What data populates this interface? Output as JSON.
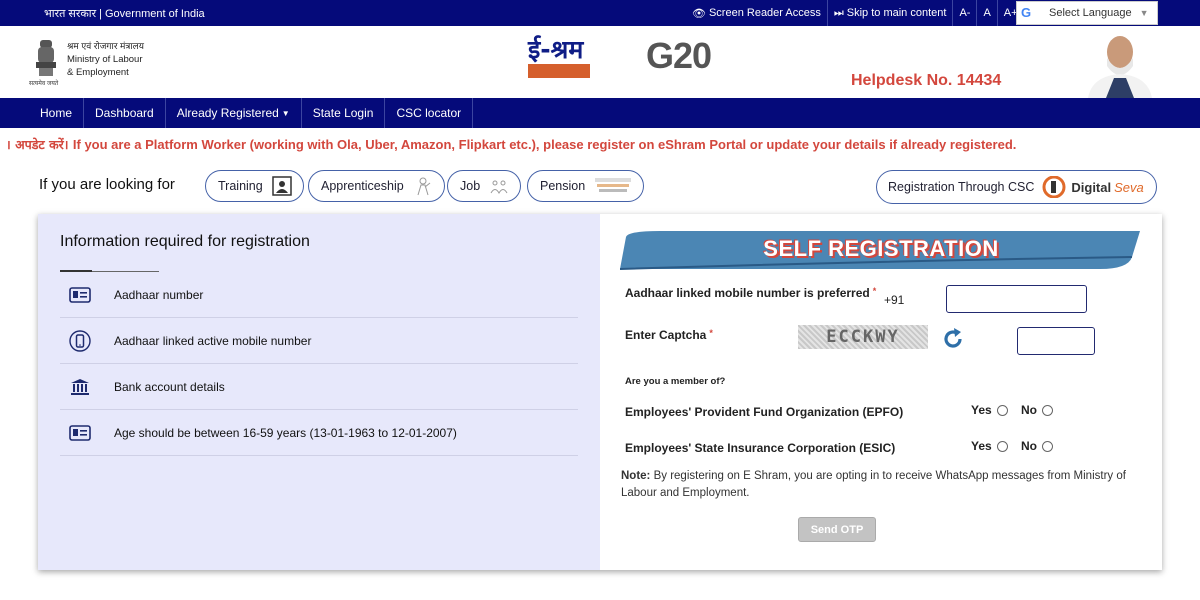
{
  "topbar": {
    "gov_hindi": "भारत सरकार",
    "gov_english": "Government of India",
    "screen_reader": "Screen Reader Access",
    "skip": "Skip to main content",
    "font_minus": "A-",
    "font_normal": "A",
    "font_plus": "A+",
    "language": "Select Language"
  },
  "header": {
    "emblem_caption": "सत्यमेव जयते",
    "ministry_hindi": "श्रम एवं रोजगार मंत्रालय",
    "ministry_line1": "Ministry of Labour",
    "ministry_line2": "& Employment",
    "eshram_word": "ई-श्रम",
    "g20_text": "G20",
    "helpdesk": "Helpdesk No. 14434"
  },
  "nav": {
    "tabs": [
      "Home",
      "Dashboard",
      "Already Registered",
      "State Login",
      "CSC locator"
    ]
  },
  "marquee": {
    "hindi": "। अपडेट करें।",
    "english": "If you are a Platform Worker (working with Ola, Uber, Amazon, Flipkart etc.), please register on eShram Portal or update your details if already registered."
  },
  "looking": {
    "label": "If you are looking for",
    "options": [
      "Training",
      "Apprenticeship",
      "Job",
      "Pension"
    ],
    "csc": "Registration Through CSC",
    "digital": "Digital",
    "seva": "Seva"
  },
  "info": {
    "title": "Information required for registration",
    "items": [
      "Aadhaar number",
      "Aadhaar linked active mobile number",
      "Bank account details",
      "Age should be between 16-59 years (13-01-1963 to 12-01-2007)"
    ]
  },
  "registration": {
    "title": "SELF REGISTRATION",
    "mobile_label": "Aadhaar linked mobile number is preferred",
    "mobile_prefix": "+91",
    "captcha_label": "Enter Captcha",
    "captcha_text": "ECCKWY",
    "member_question": "Are you a member of?",
    "epfo": "Employees' Provident Fund Organization (EPFO)",
    "esic": "Employees' State Insurance Corporation (ESIC)",
    "yes": "Yes",
    "no": "No",
    "note_label": "Note:",
    "note_text": "By registering on E Shram, you are opting in to receive WhatsApp messages from Ministry of Labour and Employment.",
    "send_button": "Send OTP"
  },
  "colors": {
    "navy": "#050a7a",
    "accent_red": "#d3473d",
    "info_panel": "#e7e8fb",
    "banner_blue": "#4b86b4"
  }
}
